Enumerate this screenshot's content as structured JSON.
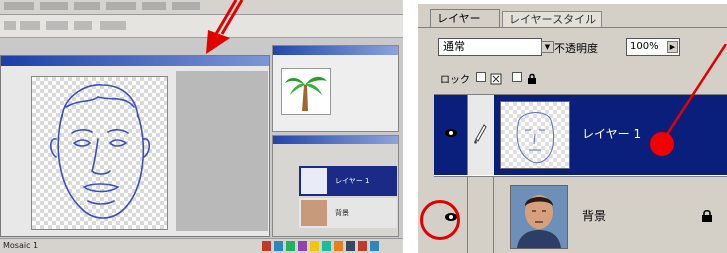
{
  "left_screenshot": {
    "status_zoom": "Mosaic 1",
    "mini_layer_name": "レイヤー 1",
    "mini_bg_name": "背景"
  },
  "layers_palette": {
    "tabs": [
      {
        "label": "レイヤー"
      },
      {
        "label": "レイヤースタイル"
      }
    ],
    "blend_mode": "通常",
    "opacity_label": "不透明度",
    "opacity_value": "100%",
    "lock_label": "ロック",
    "layers": [
      {
        "name": "レイヤー 1",
        "selected": true
      },
      {
        "name": "背景",
        "selected": false
      }
    ]
  },
  "colors": {
    "selection_blue": "#0a1f7c",
    "annotation_red": "#e30000",
    "face_line": "#3c4fc6"
  }
}
